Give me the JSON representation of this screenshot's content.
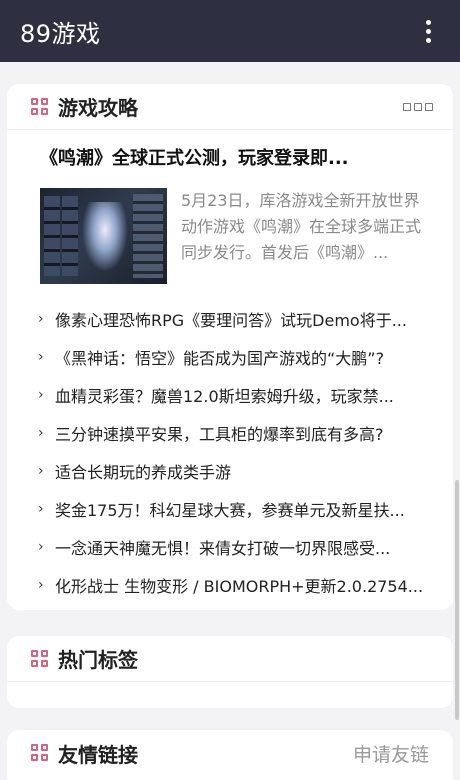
{
  "app": {
    "title": "89游戏"
  },
  "guide": {
    "title": "游戏攻略",
    "featured": {
      "title": "《鸣潮》全球正式公测，玩家登录即...",
      "summary": "5月23日，库洛游戏全新开放世界动作游戏《鸣潮》在全球多端正式同步发行。首发后《鸣潮》..."
    },
    "items": [
      "像素心理恐怖RPG《要理问答》试玩Demo将于...",
      "《黑神话：悟空》能否成为国产游戏的“大鹏”?",
      "血精灵彩蛋？魔兽12.0斯坦索姆升级，玩家禁...",
      "三分钟速摸平安果，工具柜的爆率到底有多高?",
      "适合长期玩的养成类手游",
      "奖金175万！科幻星球大赛，参赛单元及新星扶...",
      "一念通天神魔无惧！来倩女打破一切界限感受...",
      "化形战士 生物变形 / BIOMORPH+更新2.0.2754..."
    ]
  },
  "tags": {
    "title": "热门标签"
  },
  "links": {
    "title": "友情链接",
    "apply": "申请友链"
  },
  "colors": {
    "topbar": "#2e3042",
    "accent": "#d9627f",
    "background": "#f3f3f5"
  }
}
